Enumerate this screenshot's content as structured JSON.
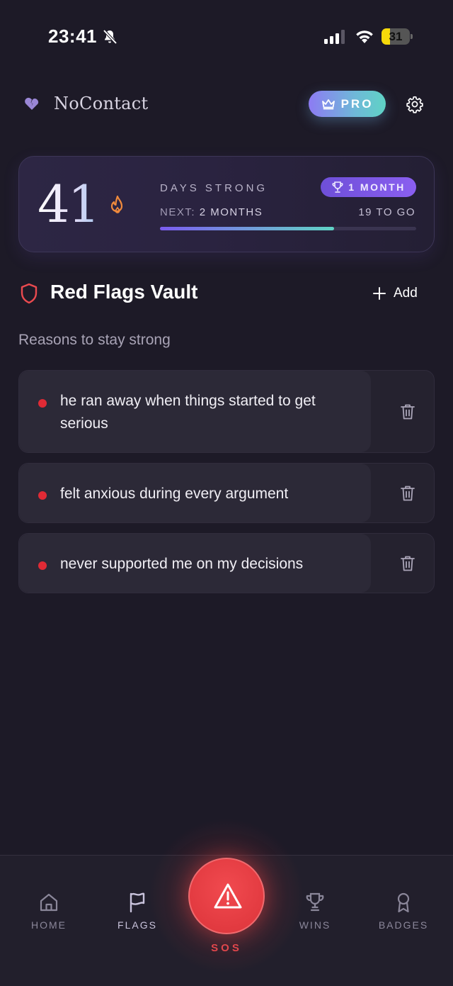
{
  "status_bar": {
    "time": "23:41",
    "battery_level": "31",
    "battery_fraction": 0.31,
    "bell_icon": "bell-slash-icon",
    "signal_icon": "cellular-signal-icon",
    "wifi_icon": "wifi-icon"
  },
  "header": {
    "brand_icon": "broken-heart-icon",
    "app_name": "NoContact",
    "pro_label": "PRO",
    "pro_icon": "crown-icon",
    "settings_icon": "gear-icon"
  },
  "streak": {
    "days": "41",
    "flame_icon": "flame-icon",
    "label": "DAYS STRONG",
    "badge_icon": "trophy-icon",
    "badge_label": "1 MONTH",
    "next_prefix": "NEXT:",
    "next_value": "2 MONTHS",
    "to_go": "19 TO GO",
    "progress": 0.68
  },
  "vault": {
    "icon": "shield-icon",
    "title": "Red Flags Vault",
    "add_label": "Add",
    "subtitle": "Reasons to stay strong",
    "items": [
      {
        "text": "he ran away when things started to get serious"
      },
      {
        "text": "felt anxious during every argument"
      },
      {
        "text": "never supported me on my decisions"
      }
    ]
  },
  "nav": {
    "items": [
      {
        "label": "HOME",
        "icon": "home-icon"
      },
      {
        "label": "FLAGS",
        "icon": "flag-icon"
      },
      {
        "label": "WINS",
        "icon": "trophy-icon"
      },
      {
        "label": "BADGES",
        "icon": "badge-icon"
      }
    ],
    "sos_label": "SOS",
    "sos_icon": "warning-triangle-icon",
    "active": "FLAGS"
  },
  "colors": {
    "background": "#1d1a27",
    "accent_red": "#e23a40",
    "accent_purple": "#7b5cf0",
    "accent_teal": "#5fd3c5"
  }
}
